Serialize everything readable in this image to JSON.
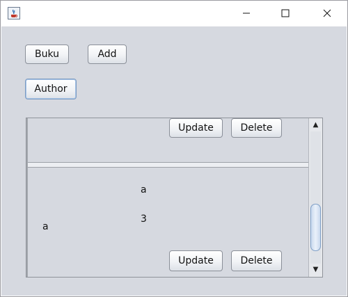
{
  "window": {
    "title": "",
    "controls": {
      "minimize": "—",
      "maximize": "☐",
      "close": "✕"
    }
  },
  "toolbar": {
    "buku_label": "Buku",
    "add_label": "Add",
    "author_label": "Author"
  },
  "list": {
    "row1": {
      "update_label": "Update",
      "delete_label": "Delete"
    },
    "row2": {
      "value_a_right": "a",
      "value_3": "3",
      "value_a_left": "a",
      "update_label": "Update",
      "delete_label": "Delete"
    }
  },
  "scrollbar": {
    "up": "▲",
    "down": "▼"
  }
}
